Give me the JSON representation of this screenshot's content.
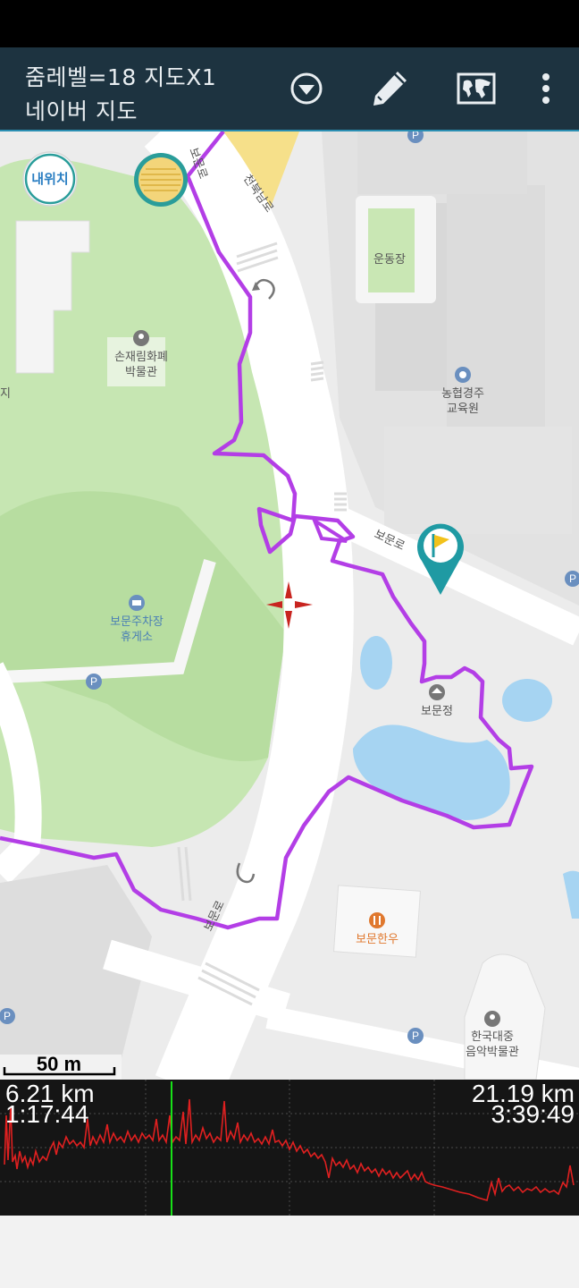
{
  "header": {
    "line1": "줌레벨=18 지도X1",
    "line2": "네이버 지도"
  },
  "toolbar": {
    "dropdown_icon": "chevron-down-circle-icon",
    "edit_icon": "pencil-icon",
    "map_icon": "world-map-icon",
    "menu_icon": "more-vert-icon"
  },
  "map": {
    "my_location_label": "내위치",
    "scale_label": "50 m",
    "labels": {
      "stadium": "운동장",
      "museum_line1": "손재림화폐",
      "museum_line2": "박물관",
      "nh_line1": "농협경주",
      "nh_line2": "교육원",
      "rest_line1": "보문주차장",
      "rest_line2": "휴게소",
      "pavilion": "보문정",
      "restaurant": "보문한우",
      "music_line1": "한국대중",
      "music_line2": "음악박물관",
      "road_bomun_a": "보문로",
      "road_bomun_b": "보문로",
      "road_bomun_c": "보문로",
      "road_cheonbuk": "천북남로",
      "edge_char": "지",
      "parking": "P"
    },
    "colors": {
      "track": "#b33ee6",
      "park": "#c6e6b2",
      "water": "#a6d4f2",
      "road": "#ffffff"
    }
  },
  "profile": {
    "left_distance": "6.21 km",
    "left_time": "1:17:44",
    "right_distance": "21.19 km",
    "right_time": "3:39:49",
    "cursor_fraction": 0.295
  }
}
